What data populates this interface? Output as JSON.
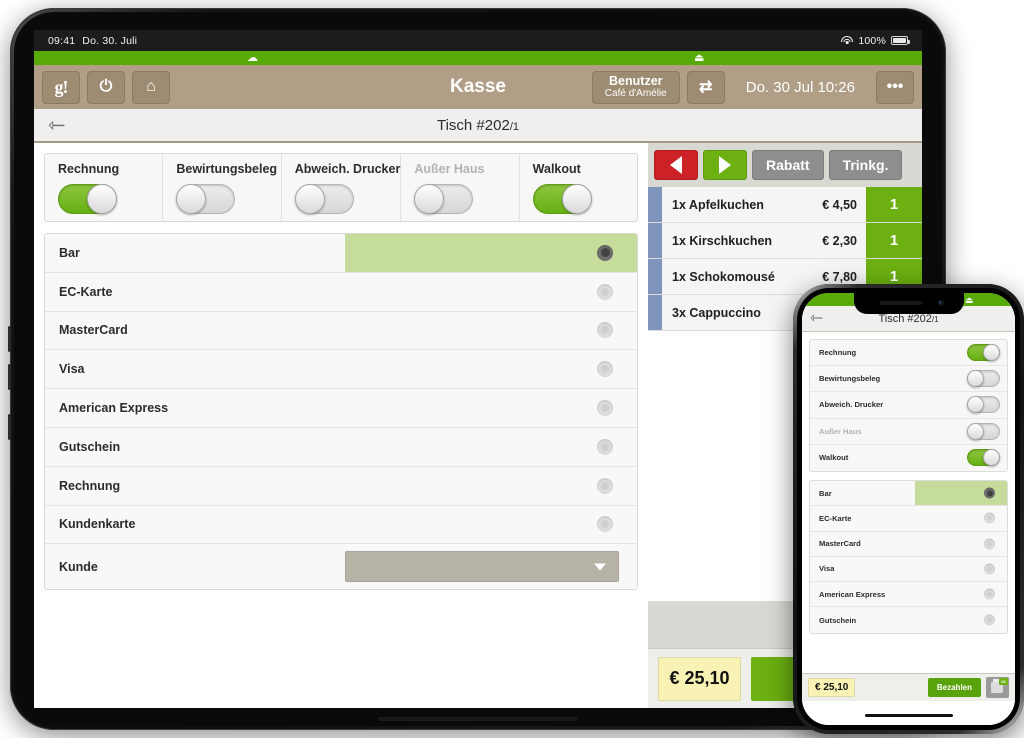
{
  "tablet": {
    "status_bar": {
      "time": "09:41",
      "date": "Do. 30. Juli",
      "battery_pct": "100%"
    },
    "sync_icons": {
      "left": "cloud-icon",
      "right": "printer-icon"
    },
    "toolbar": {
      "logo_label": "g!",
      "power_label": "⏻",
      "home_label": "⌂",
      "title": "Kasse",
      "user_title": "Benutzer",
      "user_name": "Café d'Amélie",
      "swap_label": "⇄",
      "datetime": "Do. 30 Jul 10:26",
      "more_label": "•••"
    },
    "subnav": {
      "back_icon": "back-arrow-icon",
      "title": "Tisch #202",
      "title_sub": "/1"
    },
    "toggles": [
      {
        "label": "Rechnung",
        "on": true,
        "disabled": false
      },
      {
        "label": "Bewirtungsbeleg",
        "on": false,
        "disabled": false
      },
      {
        "label": "Abweich. Drucker",
        "on": false,
        "disabled": false
      },
      {
        "label": "Außer Haus",
        "on": false,
        "disabled": true
      },
      {
        "label": "Walkout",
        "on": true,
        "disabled": false
      }
    ],
    "payment_methods": [
      {
        "label": "Bar",
        "selected": true
      },
      {
        "label": "EC-Karte",
        "selected": false
      },
      {
        "label": "MasterCard",
        "selected": false
      },
      {
        "label": "Visa",
        "selected": false
      },
      {
        "label": "American Express",
        "selected": false
      },
      {
        "label": "Gutschein",
        "selected": false
      },
      {
        "label": "Rechnung",
        "selected": false
      },
      {
        "label": "Kundenkarte",
        "selected": false
      }
    ],
    "customer_row": {
      "label": "Kunde",
      "value": ""
    },
    "right_pane": {
      "buttons": {
        "prev": "◀",
        "next": "▶",
        "discount": "Rabatt",
        "tip": "Trinkg."
      },
      "items": [
        {
          "name": "1x Apfelkuchen",
          "price": "€ 4,50",
          "qty": "1"
        },
        {
          "name": "1x Kirschkuchen",
          "price": "€ 2,30",
          "qty": "1"
        },
        {
          "name": "1x Schokomousé",
          "price": "€ 7,80",
          "qty": "1"
        },
        {
          "name": "3x Cappuccino",
          "price": "",
          "qty": ""
        }
      ],
      "total": "€ 25,10",
      "pay_button": "Bezahlen"
    }
  },
  "phone": {
    "sync_icons": {
      "left": "cloud-icon",
      "right": "printer-icon"
    },
    "nav": {
      "back_icon": "back-arrow-icon",
      "title": "Tisch #202",
      "title_sub": "/1"
    },
    "toggles": [
      {
        "label": "Rechnung",
        "on": true,
        "disabled": false
      },
      {
        "label": "Bewirtungsbeleg",
        "on": false,
        "disabled": false
      },
      {
        "label": "Abweich. Drucker",
        "on": false,
        "disabled": false
      },
      {
        "label": "Außer Haus",
        "on": false,
        "disabled": true
      },
      {
        "label": "Walkout",
        "on": true,
        "disabled": false
      }
    ],
    "payment_methods": [
      {
        "label": "Bar",
        "selected": true
      },
      {
        "label": "EC-Karte",
        "selected": false
      },
      {
        "label": "MasterCard",
        "selected": false
      },
      {
        "label": "Visa",
        "selected": false
      },
      {
        "label": "American Express",
        "selected": false
      },
      {
        "label": "Gutschein",
        "selected": false
      }
    ],
    "bottom": {
      "total": "€ 25,10",
      "pay_button": "Bezahlen",
      "print_badge": "66"
    }
  },
  "colors": {
    "green": "#6cb011",
    "strip_green": "#58aa08",
    "brown": "#b09e86",
    "red": "#cc2127",
    "selected_row": "#c6dc9b",
    "total_yellow": "#f8f3b5",
    "order_tab_blue": "#7f95bc"
  }
}
